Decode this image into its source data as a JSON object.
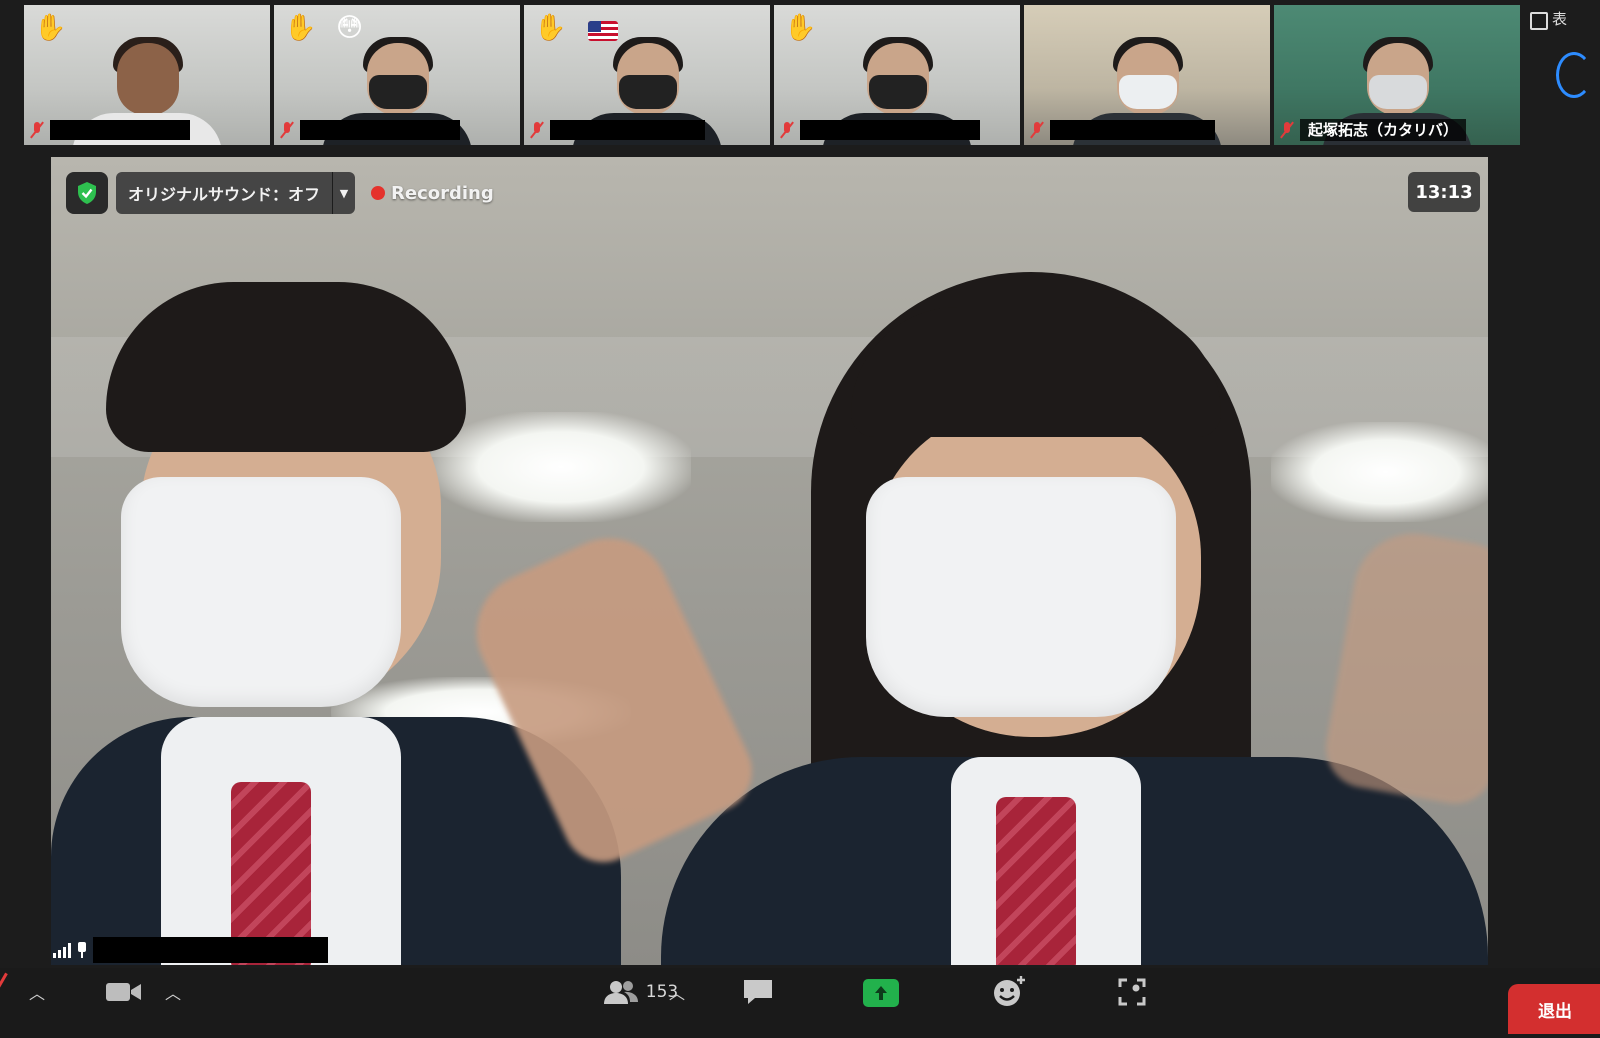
{
  "thumbnails": [
    {
      "name": "",
      "reaction_hand": "✋",
      "extra": "",
      "mask": "none"
    },
    {
      "name": "",
      "reaction_hand": "✋",
      "extra": "😳",
      "mask": "dark"
    },
    {
      "name": "",
      "reaction_hand": "✋",
      "extra": "flag-us",
      "mask": "dark"
    },
    {
      "name": "",
      "reaction_hand": "✋",
      "extra": "",
      "mask": "dark"
    },
    {
      "name": "",
      "reaction_hand": "",
      "extra": "",
      "mask": "white"
    },
    {
      "name": "起塚拓志（カタリバ）",
      "reaction_hand": "",
      "extra": "",
      "mask": "grey"
    }
  ],
  "main": {
    "original_sound_label": "オリジナルサウンド：オフ",
    "recording_label": "Recording",
    "clock": "13:13",
    "speaker_name": ""
  },
  "side": {
    "label": "表"
  },
  "toolbar": {
    "participants_count": "153",
    "leave_label": "退出"
  },
  "colors": {
    "accent_share": "#22b14c",
    "recording_dot": "#e5322c",
    "leave": "#d32f2f",
    "muted": "#e23b3b"
  }
}
